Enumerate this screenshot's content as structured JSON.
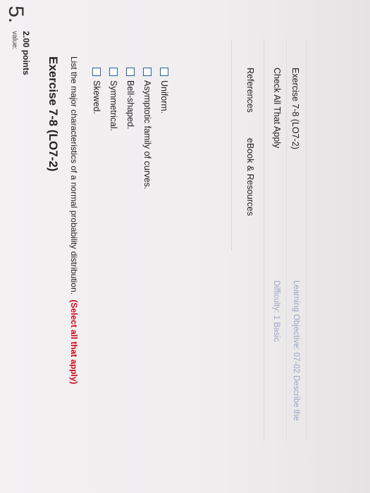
{
  "question": {
    "number": "5.",
    "value_label": "value:",
    "points": "2.00 points"
  },
  "exercise": {
    "title": "Exercise 7-8 (LO7-2)",
    "prompt": "List the major characteristics of a normal probability distribution.",
    "hint": "(Select all that apply)"
  },
  "options": [
    {
      "label": "Skewed."
    },
    {
      "label": "Symmetrical."
    },
    {
      "label": "Bell-shaped."
    },
    {
      "label": "Asymptotic family of curves."
    },
    {
      "label": "Uniform."
    }
  ],
  "footer": {
    "references": "References",
    "ebook": "eBook & Resources",
    "check_all": "Check All That Apply",
    "difficulty": "Difficulty: 1 Basic",
    "exercise_ref": "Exercise 7-8 (LO7-2)",
    "objective": "Learning Objective: 07-02 Describe the"
  },
  "colors": {
    "accent": "#1f5fa5",
    "hint_red": "#d0021b",
    "muted_link": "#9aa6c6"
  }
}
